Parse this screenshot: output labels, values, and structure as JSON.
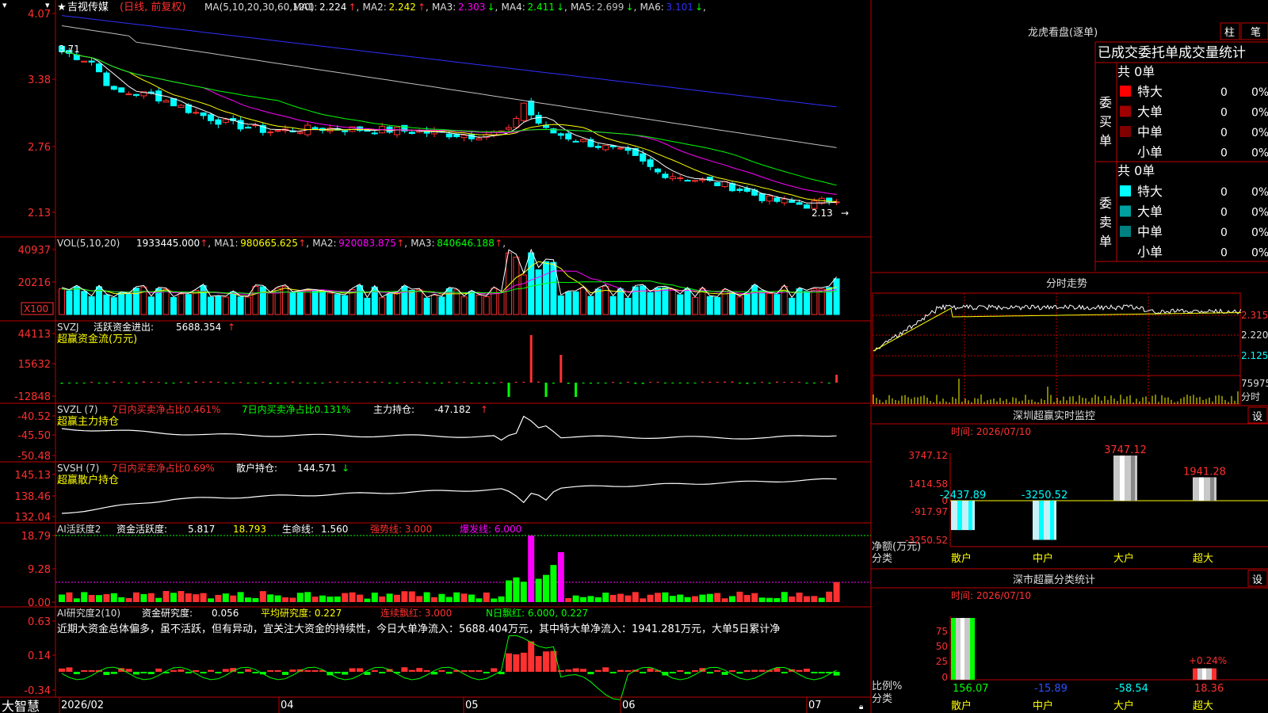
{
  "app_name": "大智慧",
  "main_panel": {
    "star": "★",
    "stock_name": "吉视传媒",
    "period": "(日线, 前复权)",
    "ma_header": "MA(5,10,20,30,60,120)",
    "ma_items": [
      {
        "label": "MA1:",
        "value": "2.224",
        "arrow": "↑",
        "color": "#ffffff"
      },
      {
        "label": "MA2:",
        "value": "2.242",
        "arrow": "↑",
        "color": "#ffff00"
      },
      {
        "label": "MA3:",
        "value": "2.303",
        "arrow": "↓",
        "color": "#ff00ff"
      },
      {
        "label": "MA4:",
        "value": "2.411",
        "arrow": "↓",
        "color": "#00ff00"
      },
      {
        "label": "MA5:",
        "value": "2.699",
        "arrow": "↓",
        "color": "#c0c0c0"
      },
      {
        "label": "MA6:",
        "value": "3.101",
        "arrow": "↓",
        "color": "#3030ff"
      }
    ],
    "y_labels": [
      "4.07",
      "3.38",
      "2.76",
      "2.13"
    ],
    "high_marker": "3.71",
    "low_marker": "2.13",
    "sidebar_widgets": [
      "▾",
      "▾"
    ]
  },
  "vol_panel": {
    "header": "VOL(5,10,20)",
    "items": [
      {
        "label": "",
        "value": "1933445.000",
        "arrow": "↑",
        "color": "#ffffff"
      },
      {
        "label": "MA1:",
        "value": "980665.625",
        "arrow": "↑",
        "color": "#ffff00"
      },
      {
        "label": "MA2:",
        "value": "920083.875",
        "arrow": "↑",
        "color": "#ff00ff"
      },
      {
        "label": "MA3:",
        "value": "840646.188",
        "arrow": "↑",
        "color": "#00ff00"
      }
    ],
    "y_labels": [
      "40937",
      "20216"
    ],
    "unit": "X100"
  },
  "svzj_panel": {
    "header": "SVZJ",
    "item_label": "活跃资金进出:",
    "item_value": "5688.354",
    "arrow": "↑",
    "subtitle": "超赢资金流(万元)",
    "y_labels": [
      "44113",
      "15632",
      "-12848"
    ]
  },
  "svzl_panel": {
    "header": "SVZL (7)",
    "text1": "7日内买卖净占比0.461%",
    "text2": "7日内买卖净占比0.131%",
    "item_label": "主力持仓:",
    "item_value": "-47.182",
    "arrow": "↑",
    "subtitle": "超赢主力持仓",
    "y_labels": [
      "-40.52",
      "-45.50",
      "-50.48"
    ]
  },
  "svsh_panel": {
    "header": "SVSH (7)",
    "text1": "7日内买卖净占比0.69%",
    "item_label": "散户持仓:",
    "item_value": "144.571",
    "arrow": "↓",
    "subtitle": "超赢散户持仓",
    "y_labels": [
      "145.13",
      "138.46",
      "132.04"
    ]
  },
  "ai_active_panel": {
    "header": "AI活跃度2",
    "item_label": "资金活跃度:",
    "item_value": "5.817",
    "val2": "18.793",
    "item3_label": "生命线:",
    "item3_value": "1.560",
    "item4": "强势线: 3.000",
    "item5": "爆发线: 6.000",
    "y_labels": [
      "18.79",
      "9.28",
      "0.00"
    ]
  },
  "ai_research_panel": {
    "header": "AI研究度2(10)",
    "item_label": "资金研究度:",
    "item_value": "0.056",
    "item2": "平均研究度: 0.227",
    "item3": "连续飘红: 3.000",
    "item4": "N日飘红: 6.000, 0.227",
    "comment": "近期大资金总体偏多，虽不活跃，但有异动，宜关注大资金的持续性，今日大单净流入：5688.404万元，其中特大单净流入：1941.281万元，大单5日累计净",
    "y_labels": [
      "0.63",
      "0.14",
      "-0.34"
    ]
  },
  "x_axis": {
    "labels": [
      "2026/02",
      "04",
      "05",
      "06",
      "07"
    ]
  },
  "dragon_tiger": {
    "title": "龙虎看盘(逐单)",
    "tab1": "柱",
    "tab2": "笔",
    "stat_title": "已成交委托单成交量统计",
    "buy_label": "委买单",
    "sell_label": "委卖单",
    "buy_total": "共 0单",
    "sell_total": "共 0单",
    "buy_rows": [
      {
        "label": "特大",
        "value": "0",
        "pct": "0%",
        "color": "#ff0000"
      },
      {
        "label": "大单",
        "value": "0",
        "pct": "0%",
        "color": "#a00000"
      },
      {
        "label": "中单",
        "value": "0",
        "pct": "0%",
        "color": "#800000"
      },
      {
        "label": "小单",
        "value": "0",
        "pct": "0%",
        "color": ""
      }
    ],
    "sell_rows": [
      {
        "label": "特大",
        "value": "0",
        "pct": "0%",
        "color": "#00ffff"
      },
      {
        "label": "大单",
        "value": "0",
        "pct": "0%",
        "color": "#00a0a0"
      },
      {
        "label": "中单",
        "value": "0",
        "pct": "0%",
        "color": "#008080"
      },
      {
        "label": "小单",
        "value": "0",
        "pct": "0%",
        "color": ""
      }
    ]
  },
  "intraday": {
    "title": "分时走势",
    "y_labels": [
      "2.315",
      "2.220",
      "2.125"
    ],
    "vol_label": "75975",
    "vol_unit": "分时"
  },
  "sz_monitor": {
    "title": "深圳超赢实时监控",
    "settings": "设",
    "time_label": "时间: 2026/07/10",
    "y_labels": [
      "3747.12",
      "1414.58",
      "0",
      "-917.97",
      "-3250.52"
    ],
    "unit_label": "净额(万元)",
    "cat_label": "分类",
    "categories": [
      "散户",
      "中户",
      "大户",
      "超大"
    ],
    "values": [
      "-2437.89",
      "-3250.52",
      "3747.12",
      "1941.28"
    ]
  },
  "sz_stats": {
    "title": "深市超赢分类统计",
    "settings": "设",
    "time_label": "时间: 2026/07/10",
    "y_labels": [
      "75",
      "50",
      "25",
      "0"
    ],
    "unit_label": "比例%",
    "cat_label": "分类",
    "pct_marker": "+0.24%",
    "categories": [
      "散户",
      "中户",
      "大户",
      "超大"
    ],
    "values": [
      "156.07",
      "-15.89",
      "-58.54",
      "18.36"
    ]
  }
}
